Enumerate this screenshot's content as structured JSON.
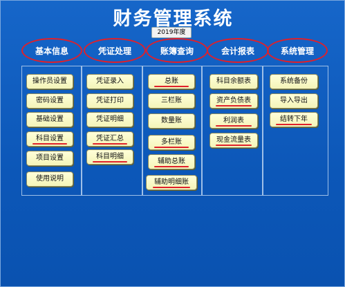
{
  "app": {
    "title": "财务管理系统",
    "year": "2019年度"
  },
  "categories": [
    {
      "label": "基本信息"
    },
    {
      "label": "凭证处理"
    },
    {
      "label": "账簿查询"
    },
    {
      "label": "会计报表"
    },
    {
      "label": "系统管理"
    }
  ],
  "menus": {
    "basic": [
      "操作员设置",
      "密码设置",
      "基础设置",
      "科目设置",
      "项目设置",
      "使用说明"
    ],
    "voucher": [
      "凭证录入",
      "凭证打印",
      "凭证明细",
      "凭证汇总",
      "科目明细"
    ],
    "ledger": [
      "总账",
      "三栏账",
      "数量账",
      "多栏账",
      "辅助总账",
      "辅助明细账"
    ],
    "reports": [
      "科目余额表",
      "资产负债表",
      "利润表",
      "现金流量表"
    ],
    "system": [
      "系统备份",
      "导入导出",
      "结转下年"
    ]
  },
  "annotations": {
    "ring_color": "#e0202a",
    "underline_color": "#e0202a"
  },
  "colors": {
    "background": "#0d5bbf",
    "button": "#f8f8c6",
    "text_light": "#ffffff"
  }
}
